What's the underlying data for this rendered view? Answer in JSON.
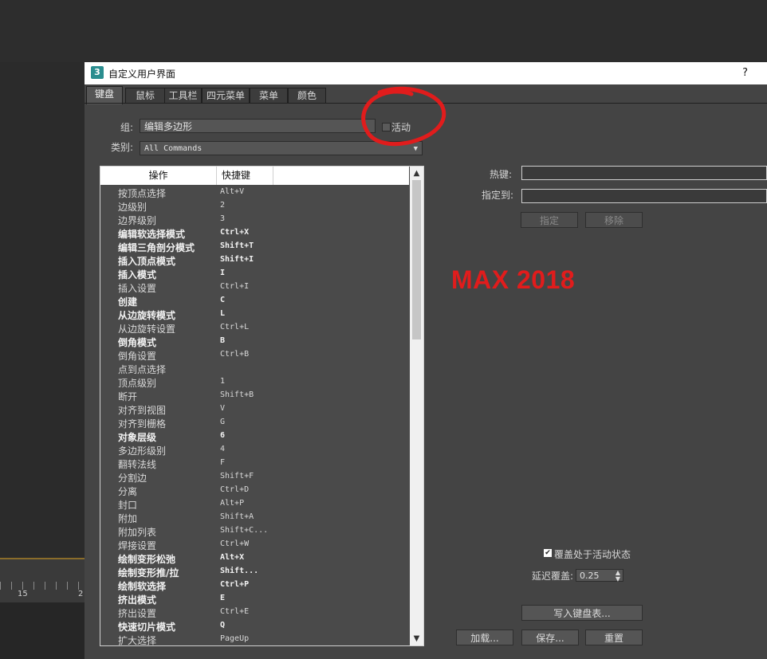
{
  "background": {
    "timeline_ticks": [
      "15",
      "2"
    ]
  },
  "window": {
    "title": "自定义用户界面",
    "help": "?",
    "app_icon": "3"
  },
  "tabs": [
    "键盘",
    "鼠标",
    "工具栏",
    "四元菜单",
    "菜单",
    "颜色"
  ],
  "active_tab": "键盘",
  "group": {
    "label": "组:",
    "value": "编辑多边形",
    "active_label": "活动"
  },
  "category": {
    "label": "类别:",
    "value": "All Commands"
  },
  "list": {
    "columns": [
      "操作",
      "快捷键"
    ],
    "rows": [
      {
        "action": "按顶点选择",
        "shortcut": "Alt+V",
        "bold": false
      },
      {
        "action": "边级别",
        "shortcut": "2",
        "bold": false
      },
      {
        "action": "边界级别",
        "shortcut": "3",
        "bold": false
      },
      {
        "action": "编辑软选择模式",
        "shortcut": "Ctrl+X",
        "bold": true
      },
      {
        "action": "编辑三角剖分模式",
        "shortcut": "Shift+T",
        "bold": true
      },
      {
        "action": "插入顶点模式",
        "shortcut": "Shift+I",
        "bold": true
      },
      {
        "action": "插入模式",
        "shortcut": "I",
        "bold": true
      },
      {
        "action": "插入设置",
        "shortcut": "Ctrl+I",
        "bold": false
      },
      {
        "action": "创建",
        "shortcut": "C",
        "bold": true
      },
      {
        "action": "从边旋转模式",
        "shortcut": "L",
        "bold": true
      },
      {
        "action": "从边旋转设置",
        "shortcut": "Ctrl+L",
        "bold": false
      },
      {
        "action": "倒角模式",
        "shortcut": "B",
        "bold": true
      },
      {
        "action": "倒角设置",
        "shortcut": "Ctrl+B",
        "bold": false
      },
      {
        "action": "点到点选择",
        "shortcut": "",
        "bold": false
      },
      {
        "action": "顶点级别",
        "shortcut": "1",
        "bold": false
      },
      {
        "action": "断开",
        "shortcut": "Shift+B",
        "bold": false
      },
      {
        "action": "对齐到视图",
        "shortcut": "V",
        "bold": false
      },
      {
        "action": "对齐到栅格",
        "shortcut": "G",
        "bold": false
      },
      {
        "action": "对象层级",
        "shortcut": "6",
        "bold": true
      },
      {
        "action": "多边形级别",
        "shortcut": "4",
        "bold": false
      },
      {
        "action": "翻转法线",
        "shortcut": "F",
        "bold": false
      },
      {
        "action": "分割边",
        "shortcut": "Shift+F",
        "bold": false
      },
      {
        "action": "分离",
        "shortcut": "Ctrl+D",
        "bold": false
      },
      {
        "action": "封口",
        "shortcut": "Alt+P",
        "bold": false
      },
      {
        "action": "附加",
        "shortcut": "Shift+A",
        "bold": false
      },
      {
        "action": "附加列表",
        "shortcut": "Shift+C...",
        "bold": false
      },
      {
        "action": "焊接设置",
        "shortcut": "Ctrl+W",
        "bold": false
      },
      {
        "action": "绘制变形松弛",
        "shortcut": "Alt+X",
        "bold": true
      },
      {
        "action": "绘制变形推/拉",
        "shortcut": "Shift...",
        "bold": true
      },
      {
        "action": "绘制软选择",
        "shortcut": "Ctrl+P",
        "bold": true
      },
      {
        "action": "挤出模式",
        "shortcut": "E",
        "bold": true
      },
      {
        "action": "挤出设置",
        "shortcut": "Ctrl+E",
        "bold": false
      },
      {
        "action": "快速切片模式",
        "shortcut": "Q",
        "bold": true
      },
      {
        "action": "扩大选择",
        "shortcut": "PageUp",
        "bold": false
      }
    ]
  },
  "right": {
    "hotkey_label": "热键:",
    "assigned_label": "指定到:",
    "assign_button": "指定",
    "remove_button": "移除",
    "override_label": "覆盖处于活动状态",
    "delay_label": "延迟覆盖:",
    "delay_value": "0.25",
    "write_button": "写入键盘表...",
    "load_button": "加载...",
    "save_button": "保存...",
    "reset_button": "重置"
  },
  "annotation": {
    "text": "MAX 2018",
    "color": "#e11c1c"
  }
}
